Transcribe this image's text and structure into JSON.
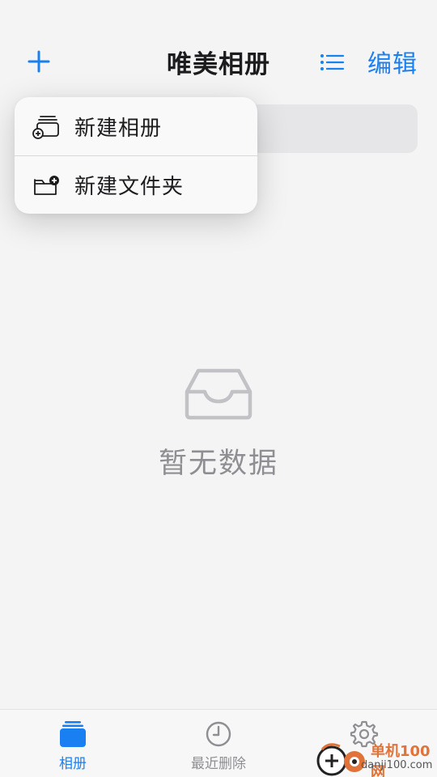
{
  "header": {
    "title": "唯美相册",
    "edit_label": "编辑",
    "add_icon": "plus-icon",
    "list_icon": "list-icon"
  },
  "menu": {
    "items": [
      {
        "label": "新建相册",
        "icon": "new-album-icon"
      },
      {
        "label": "新建文件夹",
        "icon": "new-folder-icon"
      }
    ]
  },
  "empty_state": {
    "icon": "inbox-tray-icon",
    "text": "暂无数据"
  },
  "tabs": [
    {
      "label": "相册",
      "icon": "albums-icon",
      "active": true
    },
    {
      "label": "最近删除",
      "icon": "clock-icon",
      "active": false
    },
    {
      "label": "",
      "icon": "gear-icon",
      "active": false
    }
  ],
  "watermark": {
    "line1": "单机100网",
    "line2": "danji100.com"
  },
  "colors": {
    "accent": "#1a7ff0",
    "background": "#f4f4f4",
    "muted": "#8e8e93"
  }
}
